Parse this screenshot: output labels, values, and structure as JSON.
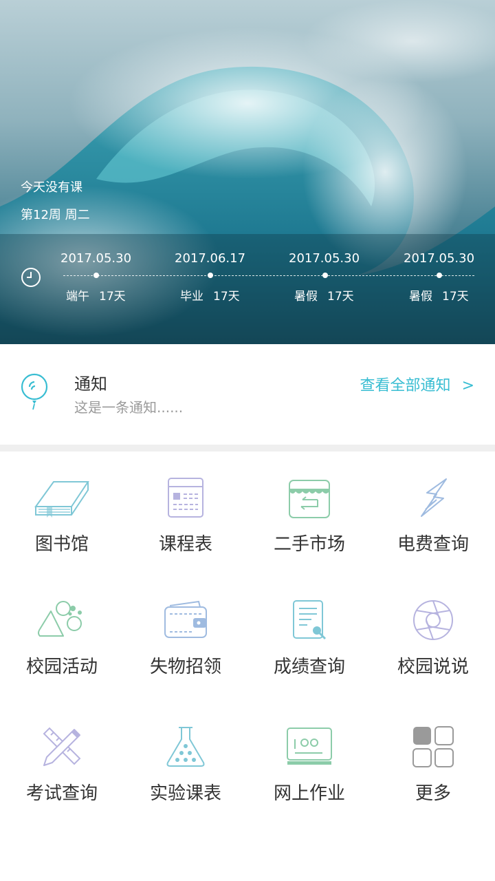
{
  "hero": {
    "status_text": "今天没有课",
    "week_text": "第12周 周二",
    "timeline": [
      {
        "date": "2017.05.30",
        "event": "端午",
        "days": "17天"
      },
      {
        "date": "2017.06.17",
        "event": "毕业",
        "days": "17天"
      },
      {
        "date": "2017.05.30",
        "event": "暑假",
        "days": "17天"
      },
      {
        "date": "2017.05.30",
        "event": "暑假",
        "days": "17天"
      }
    ]
  },
  "notice": {
    "title": "通知",
    "content": "这是一条通知......",
    "view_all": "查看全部通知",
    "chevron": ">"
  },
  "grid": [
    {
      "label": "图书馆",
      "icon": "book-icon"
    },
    {
      "label": "课程表",
      "icon": "calendar-icon"
    },
    {
      "label": "二手市场",
      "icon": "store-icon"
    },
    {
      "label": "电费查询",
      "icon": "lightning-icon"
    },
    {
      "label": "校园活动",
      "icon": "activity-icon"
    },
    {
      "label": "失物招领",
      "icon": "wallet-icon"
    },
    {
      "label": "成绩查询",
      "icon": "document-search-icon"
    },
    {
      "label": "校园说说",
      "icon": "aperture-icon"
    },
    {
      "label": "考试查询",
      "icon": "pencil-ruler-icon"
    },
    {
      "label": "实验课表",
      "icon": "flask-icon"
    },
    {
      "label": "网上作业",
      "icon": "monitor-icon"
    },
    {
      "label": "更多",
      "icon": "more-grid-icon"
    }
  ],
  "colors": {
    "accent": "#38bdd2",
    "icon_teal": "#7fc7d6",
    "icon_purple": "#b6b3df",
    "icon_green": "#8ccca9",
    "icon_blue": "#9fbbe0",
    "icon_gray": "#9a9a9a"
  }
}
